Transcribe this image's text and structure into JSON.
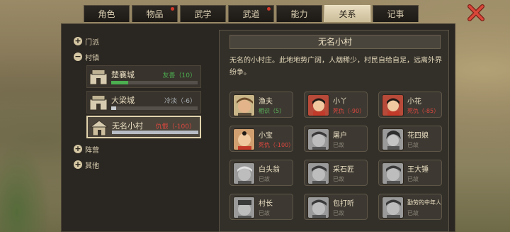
{
  "tabs": [
    {
      "label": "角色",
      "active": false,
      "badge": false
    },
    {
      "label": "物品",
      "active": false,
      "badge": true
    },
    {
      "label": "武学",
      "active": false,
      "badge": false
    },
    {
      "label": "武道",
      "active": false,
      "badge": true
    },
    {
      "label": "能力",
      "active": false,
      "badge": false
    },
    {
      "label": "关系",
      "active": true,
      "badge": false
    },
    {
      "label": "记事",
      "active": false,
      "badge": false
    }
  ],
  "tree": {
    "sect": {
      "toggle": "+",
      "label": "门派"
    },
    "village": {
      "toggle": "−",
      "label": "村镇"
    },
    "camp": {
      "toggle": "+",
      "label": "阵营"
    },
    "other": {
      "toggle": "+",
      "label": "其他"
    }
  },
  "places": [
    {
      "name": "楚襄城",
      "relation": "友善（10）",
      "level": 0.2,
      "status_color": "#4caf50",
      "selected": false
    },
    {
      "name": "大梁城",
      "relation": "冷淡（-6）",
      "level": 0.06,
      "status_color": "#9aa0a6",
      "selected": false
    },
    {
      "name": "无名小村",
      "relation": "仇恨（-100）",
      "level": 1.0,
      "status_color": "#d9534f",
      "selected": true
    }
  ],
  "detail": {
    "title": "无名小村",
    "description": "无名的小村庄。此地地势广阔，人烟稀少，村民自给自足，远离外界纷争。"
  },
  "npcs": [
    {
      "name": "渔夫",
      "status": "相识（5）",
      "status_color": "#5cb85c",
      "alive": true
    },
    {
      "name": "小丫",
      "status": "死仇（-90）",
      "status_color": "#e0473f",
      "alive": true
    },
    {
      "name": "小花",
      "status": "死仇（-85）",
      "status_color": "#e0473f",
      "alive": true
    },
    {
      "name": "小宝",
      "status": "死仇（-100）",
      "status_color": "#e0473f",
      "alive": true
    },
    {
      "name": "屠户",
      "status": "已故",
      "status_color": "#8a8378",
      "alive": false
    },
    {
      "name": "花四娘",
      "status": "已故",
      "status_color": "#8a8378",
      "alive": false
    },
    {
      "name": "白头翁",
      "status": "已故",
      "status_color": "#8a8378",
      "alive": false
    },
    {
      "name": "采石匠",
      "status": "已故",
      "status_color": "#8a8378",
      "alive": false
    },
    {
      "name": "王大锤",
      "status": "已故",
      "status_color": "#8a8378",
      "alive": false
    },
    {
      "name": "村长",
      "status": "已故",
      "status_color": "#8a8378",
      "alive": false
    },
    {
      "name": "包打听",
      "status": "已故",
      "status_color": "#8a8378",
      "alive": false
    },
    {
      "name": "勤劳的中年人",
      "status": "已故",
      "status_color": "#8a8378",
      "alive": false
    }
  ],
  "icons": {
    "close": "close-x-icon",
    "place": "city-gate-icon",
    "portrait": "npc-portrait-icon"
  },
  "colors": {
    "accent_red": "#d23a2a",
    "panel": "#33302a",
    "tab_active": "#e8dcc0"
  }
}
